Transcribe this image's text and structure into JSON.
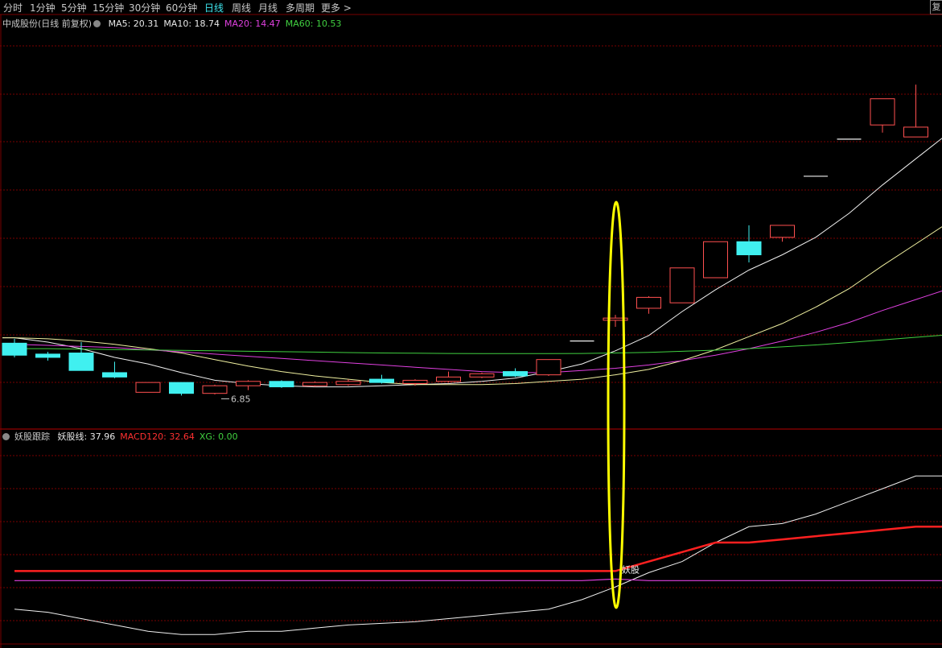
{
  "toolbar": {
    "periods": [
      "分时",
      "1分钟",
      "5分钟",
      "15分钟",
      "30分钟",
      "60分钟",
      "日线",
      "周线",
      "月线",
      "多周期",
      "更多 >"
    ],
    "active_period": "日线",
    "corner_label": "复"
  },
  "main_legend": {
    "title": "中成股份(日线 前复权)",
    "items": [
      {
        "label": "MA5: 20.31",
        "color": "#e8e8e8"
      },
      {
        "label": "MA10: 18.74",
        "color": "#e8e8e8"
      },
      {
        "label": "MA20: 14.47",
        "color": "#e040e0"
      },
      {
        "label": "MA60: 10.53",
        "color": "#40d040"
      }
    ]
  },
  "sub_legend": {
    "title": "妖股跟踪",
    "items": [
      {
        "label": "妖股线: 37.96",
        "color": "#e8e8e8"
      },
      {
        "label": "MACD120: 32.64",
        "color": "#ff3030"
      },
      {
        "label": "XG: 0.00",
        "color": "#40d040"
      }
    ]
  },
  "colors": {
    "up": "#ff5050",
    "down": "#40f0f0",
    "grid": "#7a0000",
    "highlight": "#ffff00"
  },
  "chart_data": [
    {
      "type": "candlestick",
      "title": "中成股份(日线 前复权)",
      "ylim": [
        5.5,
        23.5
      ],
      "low_annotation": {
        "index": 6,
        "label": "6.85",
        "value": 6.85
      },
      "candles": [
        {
          "o": 9.25,
          "c": 8.7,
          "h": 9.45,
          "l": 8.6
        },
        {
          "o": 8.75,
          "c": 8.6,
          "h": 8.85,
          "l": 8.45
        },
        {
          "o": 8.8,
          "c": 8.0,
          "h": 9.3,
          "l": 8.0
        },
        {
          "o": 7.9,
          "c": 7.7,
          "h": 8.4,
          "l": 7.65
        },
        {
          "o": 7.0,
          "c": 7.45,
          "h": 7.45,
          "l": 7.0
        },
        {
          "o": 7.45,
          "c": 6.95,
          "h": 7.45,
          "l": 6.85
        },
        {
          "o": 6.95,
          "c": 7.3,
          "h": 7.35,
          "l": 6.9
        },
        {
          "o": 7.3,
          "c": 7.5,
          "h": 7.55,
          "l": 7.1
        },
        {
          "o": 7.5,
          "c": 7.25,
          "h": 7.55,
          "l": 7.2
        },
        {
          "o": 7.3,
          "c": 7.45,
          "h": 7.5,
          "l": 7.25
        },
        {
          "o": 7.35,
          "c": 7.5,
          "h": 7.6,
          "l": 7.3
        },
        {
          "o": 7.6,
          "c": 7.45,
          "h": 7.8,
          "l": 7.4
        },
        {
          "o": 7.4,
          "c": 7.55,
          "h": 7.6,
          "l": 7.3
        },
        {
          "o": 7.5,
          "c": 7.7,
          "h": 7.95,
          "l": 7.45
        },
        {
          "o": 7.7,
          "c": 7.85,
          "h": 7.9,
          "l": 7.65
        },
        {
          "o": 7.95,
          "c": 7.75,
          "h": 8.1,
          "l": 7.7
        },
        {
          "o": 7.8,
          "c": 8.5,
          "h": 8.5,
          "l": 7.75
        },
        {
          "o": 9.35,
          "c": 9.35,
          "h": 9.35,
          "l": 9.35
        },
        {
          "o": 10.3,
          "c": 10.4,
          "h": 10.55,
          "l": 10.0
        },
        {
          "o": 10.85,
          "c": 11.35,
          "h": 11.4,
          "l": 10.6
        },
        {
          "o": 11.1,
          "c": 12.7,
          "h": 12.7,
          "l": 11.1
        },
        {
          "o": 12.25,
          "c": 13.9,
          "h": 13.9,
          "l": 12.25
        },
        {
          "o": 13.9,
          "c": 13.3,
          "h": 14.65,
          "l": 12.95
        },
        {
          "o": 14.1,
          "c": 14.65,
          "h": 14.65,
          "l": 13.9
        },
        {
          "o": 16.9,
          "c": 16.9,
          "h": 16.9,
          "l": 16.9
        },
        {
          "o": 18.6,
          "c": 18.6,
          "h": 18.6,
          "l": 18.6
        },
        {
          "o": 19.25,
          "c": 20.45,
          "h": 20.45,
          "l": 18.9
        },
        {
          "o": 18.7,
          "c": 19.15,
          "h": 21.1,
          "l": 18.7
        }
      ],
      "series": [
        {
          "name": "MA5",
          "color": "#f0f0f0",
          "values": [
            9.5,
            9.3,
            9.0,
            8.6,
            8.3,
            7.9,
            7.55,
            7.4,
            7.3,
            7.25,
            7.25,
            7.3,
            7.35,
            7.4,
            7.5,
            7.65,
            7.95,
            8.3,
            8.9,
            9.6,
            10.7,
            11.7,
            12.6,
            13.3,
            14.1,
            15.2,
            16.5,
            17.7
          ]
        },
        {
          "name": "MA10",
          "color": "#f0f0a0",
          "values": [
            9.5,
            9.45,
            9.35,
            9.2,
            9.0,
            8.8,
            8.5,
            8.2,
            7.95,
            7.75,
            7.6,
            7.45,
            7.35,
            7.35,
            7.35,
            7.4,
            7.5,
            7.6,
            7.8,
            8.05,
            8.45,
            8.95,
            9.55,
            10.15,
            10.9,
            11.75,
            12.8,
            13.8
          ]
        },
        {
          "name": "MA20",
          "color": "#e040e0",
          "values": [
            9.2,
            9.15,
            9.1,
            9.05,
            8.95,
            8.85,
            8.75,
            8.65,
            8.55,
            8.45,
            8.35,
            8.25,
            8.15,
            8.05,
            7.95,
            7.9,
            7.9,
            8.0,
            8.1,
            8.25,
            8.45,
            8.7,
            9.0,
            9.35,
            9.75,
            10.2,
            10.75,
            11.25
          ]
        },
        {
          "name": "MA60",
          "color": "#40d040",
          "values": [
            9.0,
            9.0,
            8.98,
            8.96,
            8.94,
            8.92,
            8.9,
            8.88,
            8.86,
            8.84,
            8.82,
            8.8,
            8.79,
            8.78,
            8.77,
            8.77,
            8.77,
            8.78,
            8.8,
            8.83,
            8.88,
            8.93,
            9.0,
            9.08,
            9.17,
            9.28,
            9.4,
            9.52
          ]
        }
      ]
    },
    {
      "type": "line",
      "title": "妖股跟踪",
      "ylim": [
        -5,
        59
      ],
      "x_count": 28,
      "signal_index": 18,
      "signal_label": "妖股",
      "series": [
        {
          "name": "妖股线",
          "color": "#f0f0f0",
          "width": 1,
          "values": [
            6,
            5,
            3,
            1,
            -1,
            -2,
            -2,
            -1,
            -1,
            0,
            1,
            1.5,
            2,
            3,
            4,
            5,
            6,
            9,
            13,
            17.5,
            21,
            27,
            32,
            33,
            36,
            40,
            44,
            48
          ]
        },
        {
          "name": "MACD120",
          "color": "#ff2020",
          "width": 2.5,
          "values": [
            18,
            18,
            18,
            18,
            18,
            18,
            18,
            18,
            18,
            18,
            18,
            18,
            18,
            18,
            18,
            18,
            18,
            18,
            18,
            21,
            24,
            27,
            27,
            28,
            29,
            30,
            31,
            32
          ]
        },
        {
          "name": "XG",
          "color": "#e040e0",
          "width": 1.2,
          "values": [
            15,
            15,
            15,
            15,
            15,
            15,
            15,
            15,
            15,
            15,
            15,
            15,
            15,
            15,
            15,
            15,
            15,
            15,
            15.5,
            15,
            15,
            15,
            15,
            15,
            15,
            15,
            15,
            15
          ]
        }
      ]
    }
  ]
}
